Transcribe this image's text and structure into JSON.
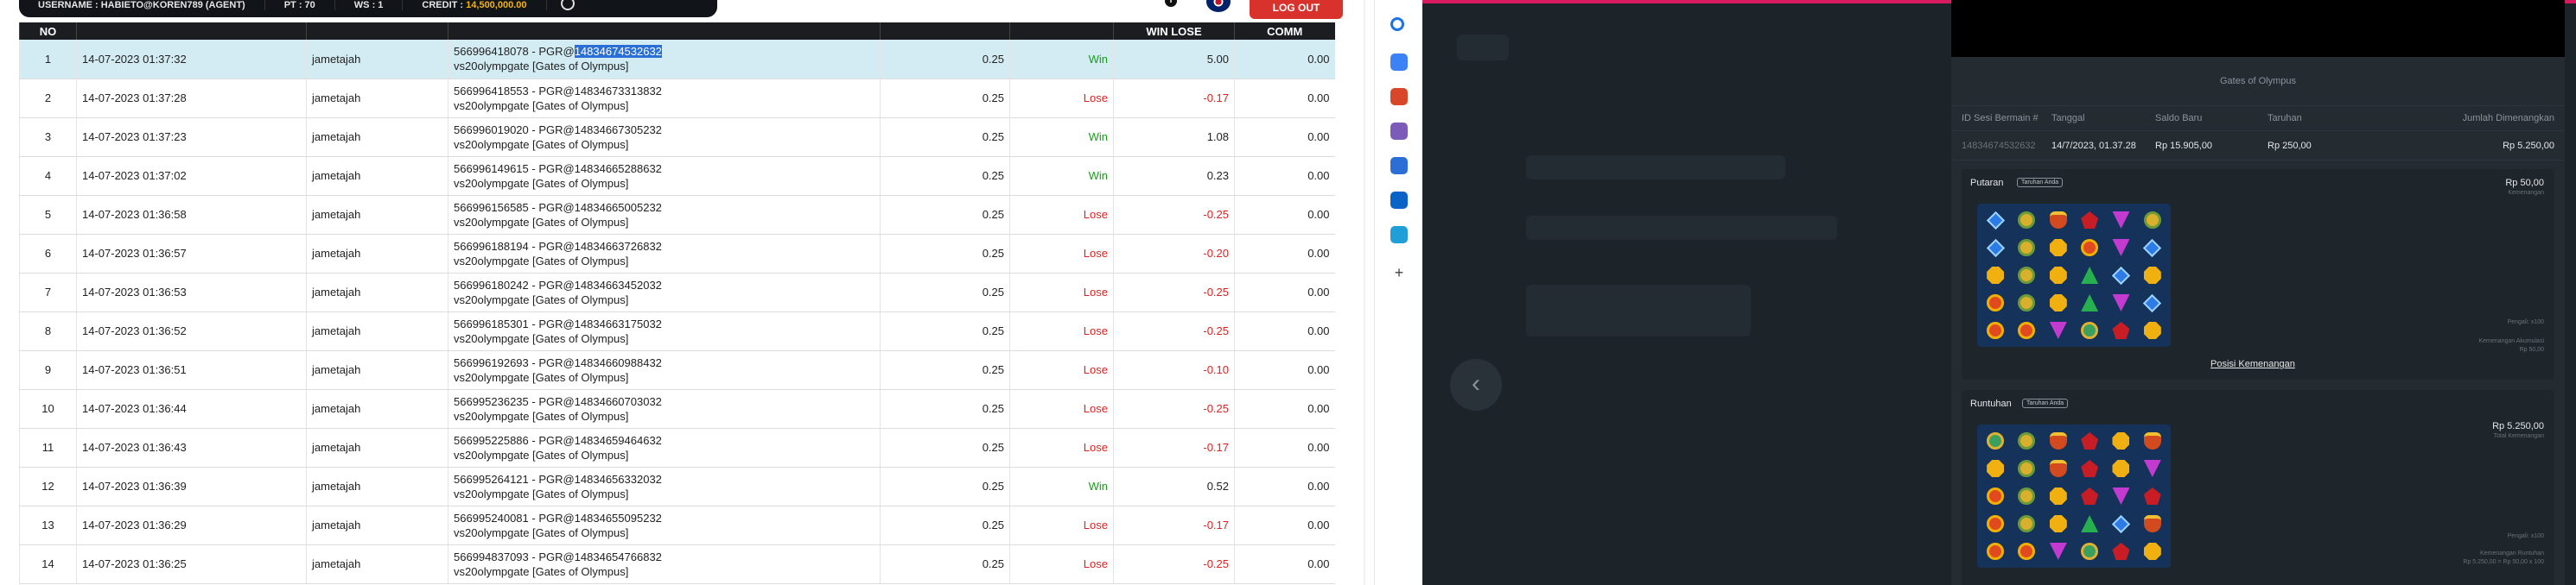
{
  "top_bar": {
    "username": "USERNAME : HABIETO@KOREN789 (AGENT)",
    "pt_label": "PT : 70",
    "ws_label": "WS : 1",
    "credit_label": "CREDIT :",
    "credit_value": "14,500,000.00",
    "logout": "LOG OUT"
  },
  "table": {
    "headers": {
      "no": "NO",
      "date": "",
      "user": "",
      "trx": "",
      "bet": "",
      "result": "",
      "winlose": "WIN LOSE",
      "comm": "COMM"
    },
    "rows": [
      {
        "no": "1",
        "date": "14-07-2023 01:37:32",
        "user": "jametajah",
        "trx_id": "566996418078 - PGR@",
        "trx_hl": "14834674532632",
        "game": "vs20olympgate [Gates of Olympus]",
        "bet": "0.25",
        "result": "Win",
        "winlose": "5.00",
        "comm": "0.00"
      },
      {
        "no": "2",
        "date": "14-07-2023 01:37:28",
        "user": "jametajah",
        "trx_id": "566996418553 - PGR@14834673313832",
        "trx_hl": "",
        "game": "vs20olympgate [Gates of Olympus]",
        "bet": "0.25",
        "result": "Lose",
        "winlose": "-0.17",
        "comm": "0.00"
      },
      {
        "no": "3",
        "date": "14-07-2023 01:37:23",
        "user": "jametajah",
        "trx_id": "566996019020 - PGR@14834667305232",
        "trx_hl": "",
        "game": "vs20olympgate [Gates of Olympus]",
        "bet": "0.25",
        "result": "Win",
        "winlose": "1.08",
        "comm": "0.00"
      },
      {
        "no": "4",
        "date": "14-07-2023 01:37:02",
        "user": "jametajah",
        "trx_id": "566996149615 - PGR@14834665288632",
        "trx_hl": "",
        "game": "vs20olympgate [Gates of Olympus]",
        "bet": "0.25",
        "result": "Win",
        "winlose": "0.23",
        "comm": "0.00"
      },
      {
        "no": "5",
        "date": "14-07-2023 01:36:58",
        "user": "jametajah",
        "trx_id": "566996156585 - PGR@14834665005232",
        "trx_hl": "",
        "game": "vs20olympgate [Gates of Olympus]",
        "bet": "0.25",
        "result": "Lose",
        "winlose": "-0.25",
        "comm": "0.00"
      },
      {
        "no": "6",
        "date": "14-07-2023 01:36:57",
        "user": "jametajah",
        "trx_id": "566996188194 - PGR@14834663726832",
        "trx_hl": "",
        "game": "vs20olympgate [Gates of Olympus]",
        "bet": "0.25",
        "result": "Lose",
        "winlose": "-0.20",
        "comm": "0.00"
      },
      {
        "no": "7",
        "date": "14-07-2023 01:36:53",
        "user": "jametajah",
        "trx_id": "566996180242 - PGR@14834663452032",
        "trx_hl": "",
        "game": "vs20olympgate [Gates of Olympus]",
        "bet": "0.25",
        "result": "Lose",
        "winlose": "-0.25",
        "comm": "0.00"
      },
      {
        "no": "8",
        "date": "14-07-2023 01:36:52",
        "user": "jametajah",
        "trx_id": "566996185301 - PGR@14834663175032",
        "trx_hl": "",
        "game": "vs20olympgate [Gates of Olympus]",
        "bet": "0.25",
        "result": "Lose",
        "winlose": "-0.25",
        "comm": "0.00"
      },
      {
        "no": "9",
        "date": "14-07-2023 01:36:51",
        "user": "jametajah",
        "trx_id": "566996192693 - PGR@14834660988432",
        "trx_hl": "",
        "game": "vs20olympgate [Gates of Olympus]",
        "bet": "0.25",
        "result": "Lose",
        "winlose": "-0.10",
        "comm": "0.00"
      },
      {
        "no": "10",
        "date": "14-07-2023 01:36:44",
        "user": "jametajah",
        "trx_id": "566995236235 - PGR@14834660703032",
        "trx_hl": "",
        "game": "vs20olympgate [Gates of Olympus]",
        "bet": "0.25",
        "result": "Lose",
        "winlose": "-0.25",
        "comm": "0.00"
      },
      {
        "no": "11",
        "date": "14-07-2023 01:36:43",
        "user": "jametajah",
        "trx_id": "566995225886 - PGR@14834659464632",
        "trx_hl": "",
        "game": "vs20olympgate [Gates of Olympus]",
        "bet": "0.25",
        "result": "Lose",
        "winlose": "-0.17",
        "comm": "0.00"
      },
      {
        "no": "12",
        "date": "14-07-2023 01:36:39",
        "user": "jametajah",
        "trx_id": "566995264121 - PGR@14834656332032",
        "trx_hl": "",
        "game": "vs20olympgate [Gates of Olympus]",
        "bet": "0.25",
        "result": "Win",
        "winlose": "0.52",
        "comm": "0.00"
      },
      {
        "no": "13",
        "date": "14-07-2023 01:36:29",
        "user": "jametajah",
        "trx_id": "566995240081 - PGR@14834655095232",
        "trx_hl": "",
        "game": "vs20olympgate [Gates of Olympus]",
        "bet": "0.25",
        "result": "Lose",
        "winlose": "-0.17",
        "comm": "0.00"
      },
      {
        "no": "14",
        "date": "14-07-2023 01:36:25",
        "user": "jametajah",
        "trx_id": "566994837093 - PGR@14834654766832",
        "trx_hl": "",
        "game": "vs20olympgate [Gates of Olympus]",
        "bet": "0.25",
        "result": "Lose",
        "winlose": "-0.25",
        "comm": "0.00"
      }
    ]
  },
  "rail_icons": [
    {
      "name": "search-icon",
      "color": "#1a73e8"
    },
    {
      "name": "tag-icon",
      "color": "#3b82f6"
    },
    {
      "name": "briefcase-icon",
      "color": "#d9472b"
    },
    {
      "name": "people-icon",
      "color": "#7b5ab8"
    },
    {
      "name": "copilot-icon",
      "color": "#2b6fd6"
    },
    {
      "name": "outlook-icon",
      "color": "#0a64c8"
    },
    {
      "name": "send-icon",
      "color": "#1f9ed8"
    },
    {
      "name": "plus-icon",
      "color": "#444444"
    }
  ],
  "game": {
    "title": "Gates of Olympus",
    "headers": [
      "ID Sesi Bermain #",
      "Tanggal",
      "Saldo Baru",
      "Taruhan",
      "Jumlah Dimenangkan"
    ],
    "row": [
      "14834674532632",
      "14/7/2023, 01.37.28",
      "Rp 15.905,00",
      "Rp 250,00",
      "Rp 5.250,00"
    ],
    "spin_title": "Putaran",
    "spin_badge": "Taruhan Anda",
    "spin_amount": "Rp 50,00",
    "spin_sub": "Kemenangan",
    "win_pos_link": "Posisi Kemenangan",
    "tumble_title": "Runtuhan",
    "tumble_badge": "Taruhan Anda",
    "tumble_amount": "Rp 5.250,00",
    "tumble_sub": "Total Kemenangan",
    "mult_label": "Pengali: x100",
    "mult_label2": "Pengali: x100",
    "gains_label": "Kemenangan Akumulasi",
    "gains_value": "Rp 50,00",
    "gains_label2": "Kemenangan Runtuhan",
    "gains_value2": "Rp 5.250,00 = Rp 50,00 x 100"
  },
  "colors": {
    "win": "#1a9c1a",
    "lose": "#e02020",
    "selected_row": "#d3ecf4",
    "logout": "#d9312b",
    "accent_bar": "#d81b60"
  }
}
